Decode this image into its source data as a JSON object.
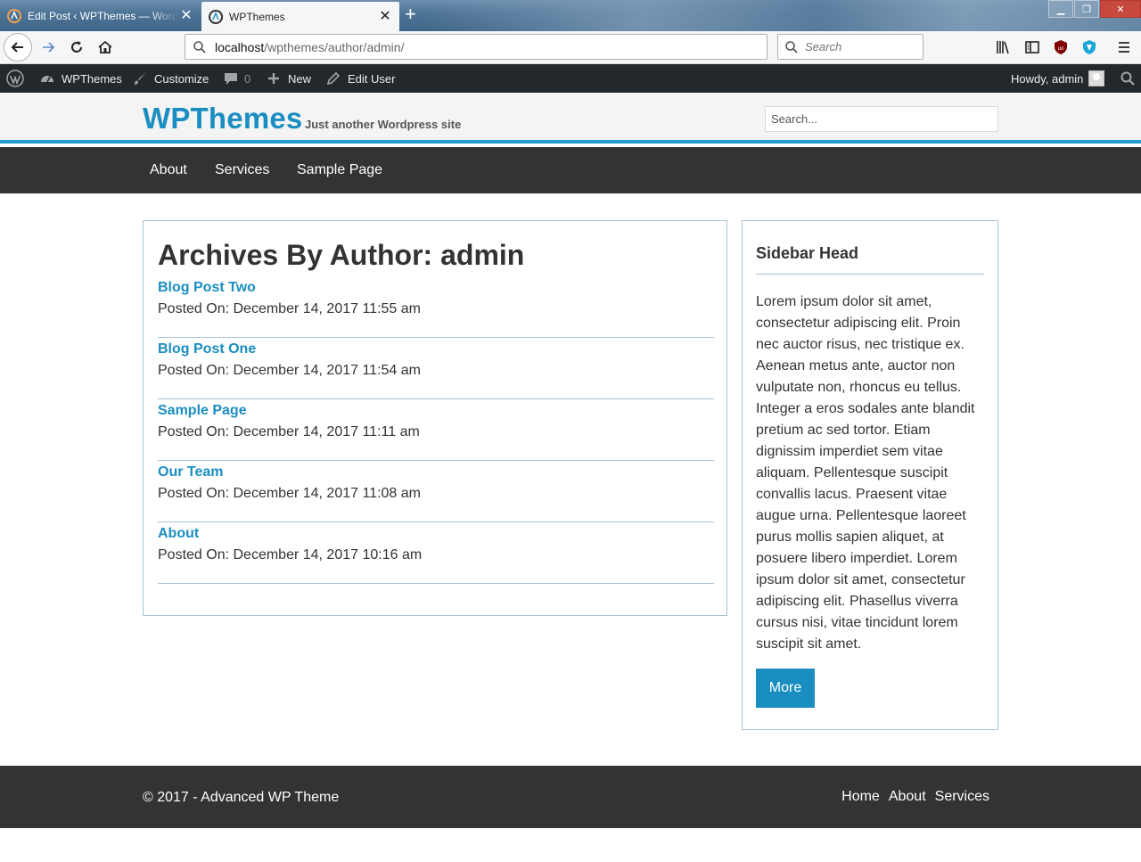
{
  "browser": {
    "tabs": [
      {
        "title": "Edit Post ‹ WPThemes — WordPress",
        "active": false
      },
      {
        "title": "WPThemes",
        "active": true
      }
    ],
    "url": {
      "host": "localhost",
      "path": "/wpthemes/author/admin/"
    },
    "search_placeholder": "Search"
  },
  "adminbar": {
    "site": "WPThemes",
    "customize": "Customize",
    "comments_count": "0",
    "new": "New",
    "edit_user": "Edit User",
    "howdy": "Howdy, admin"
  },
  "site": {
    "title": "WPThemes",
    "description": "Just another Wordpress site",
    "search_placeholder": "Search...",
    "nav": [
      "About",
      "Services",
      "Sample Page"
    ]
  },
  "archive": {
    "title": "Archives By Author: admin",
    "posts": [
      {
        "title": "Blog Post Two",
        "meta": "Posted On: December 14, 2017 11:55 am"
      },
      {
        "title": "Blog Post One",
        "meta": "Posted On: December 14, 2017 11:54 am"
      },
      {
        "title": "Sample Page",
        "meta": "Posted On: December 14, 2017 11:11 am"
      },
      {
        "title": "Our Team",
        "meta": "Posted On: December 14, 2017 11:08 am"
      },
      {
        "title": "About",
        "meta": "Posted On: December 14, 2017 10:16 am"
      }
    ]
  },
  "sidebar": {
    "head": "Sidebar Head",
    "text": "Lorem ipsum dolor sit amet, consectetur adipiscing elit. Proin nec auctor risus, nec tristique ex. Aenean metus ante, auctor non vulputate non, rhoncus eu tellus. Integer a eros sodales ante blandit pretium ac sed tortor. Etiam dignissim imperdiet sem vitae aliquam. Pellentesque suscipit convallis lacus. Praesent vitae augue urna. Pellentesque laoreet purus mollis sapien aliquet, at posuere libero imperdiet. Lorem ipsum dolor sit amet, consectetur adipiscing elit. Phasellus viverra cursus nisi, vitae tincidunt lorem suscipit sit amet.",
    "button": "More"
  },
  "footer": {
    "copyright": "© 2017 - Advanced WP Theme",
    "nav": [
      "Home",
      "About",
      "Services"
    ]
  },
  "colors": {
    "accent": "#1b8ec1",
    "admin_bar": "#23282d",
    "nav_bg": "#333333",
    "border": "#a9c3d4"
  }
}
